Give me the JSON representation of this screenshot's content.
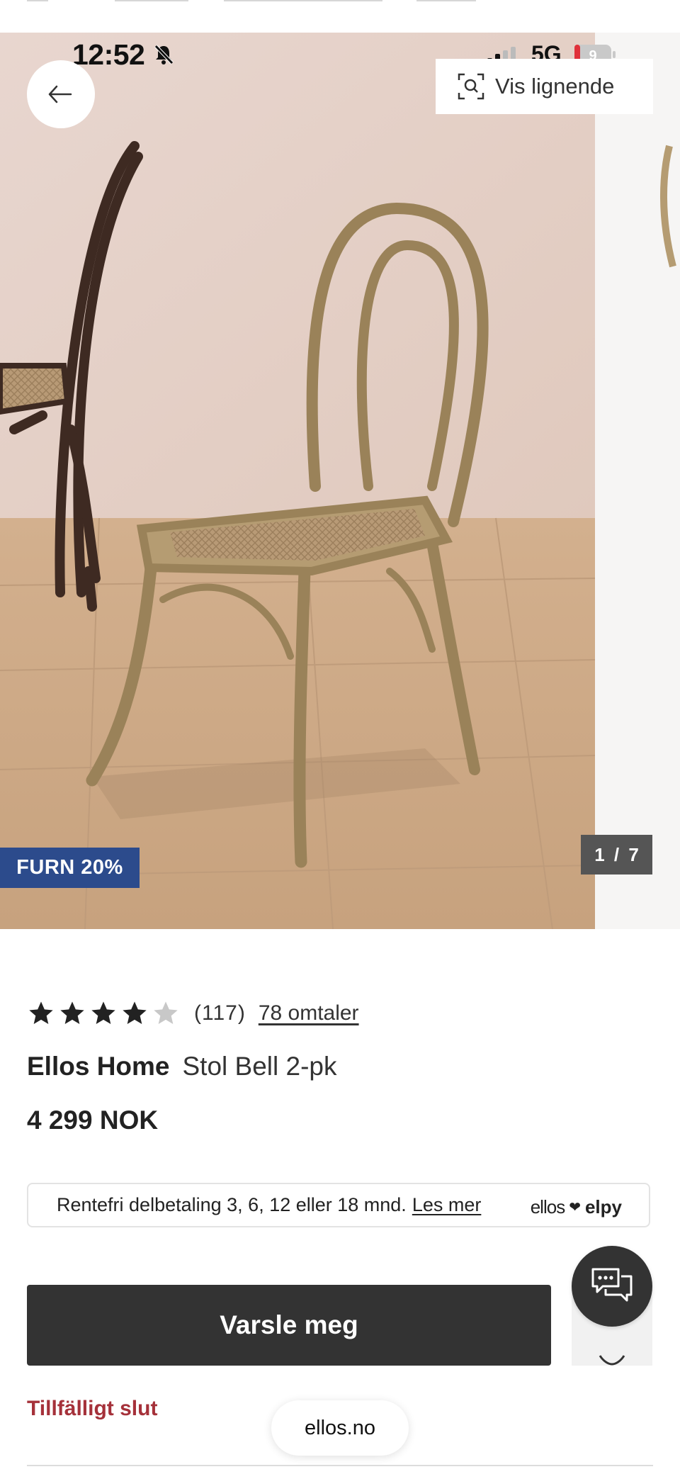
{
  "status_bar": {
    "time": "12:52",
    "network": "5G",
    "battery": "9"
  },
  "gallery": {
    "similar_label": "Vis lignende",
    "badge": "FURN 20%",
    "counter": "1 / 7"
  },
  "product": {
    "rating": 4,
    "rating_max": 5,
    "rating_count": "(117)",
    "reviews_link": "78 omtaler",
    "brand": "Ellos Home",
    "name": "Stol Bell 2-pk",
    "price": "4 299 NOK"
  },
  "installment": {
    "text": "Rentefri delbetaling 3, 6, 12 eller 18 mnd.",
    "link": "Les mer",
    "logo_part1": "ellos",
    "logo_part2": "elpy"
  },
  "actions": {
    "notify_label": "Varsle meg",
    "stock_status": "Tillfälligt slut"
  },
  "browser": {
    "url": "ellos.no"
  },
  "colors": {
    "badge": "#2c4b8c",
    "primary_button": "#333333",
    "stock_status": "#a5313a",
    "counter_bg": "#555555"
  },
  "icons": {
    "back": "arrow-left-icon",
    "similar": "visual-search-icon",
    "star": "star-icon",
    "chat": "chat-bubbles-icon",
    "wishlist": "heart-icon",
    "mute": "bell-slash-icon"
  }
}
